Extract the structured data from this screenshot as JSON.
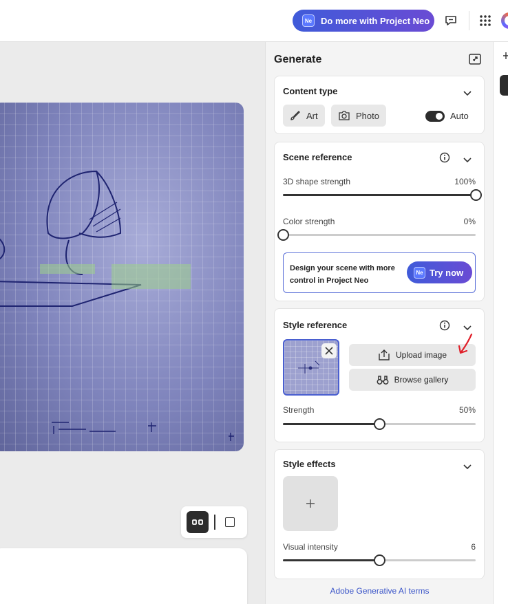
{
  "topbar": {
    "neo_button_label": "Do more with Project Neo",
    "neo_badge": "Ne"
  },
  "panel": {
    "title": "Generate",
    "content_type": {
      "title": "Content type",
      "art_label": "Art",
      "photo_label": "Photo",
      "auto_label": "Auto",
      "auto_on": true
    },
    "scene_reference": {
      "title": "Scene reference",
      "shape_label": "3D shape strength",
      "shape_value": "100%",
      "shape_level": 1.0,
      "color_label": "Color strength",
      "color_value": "0%",
      "color_level": 0.0,
      "promo_text": "Design your scene with more control in Project Neo",
      "try_label": "Try now",
      "try_badge": "Ne"
    },
    "style_reference": {
      "title": "Style reference",
      "upload_label": "Upload image",
      "browse_label": "Browse gallery",
      "strength_label": "Strength",
      "strength_value": "50%",
      "strength_level": 0.5
    },
    "style_effects": {
      "title": "Style effects",
      "intensity_label": "Visual intensity",
      "intensity_value": "6",
      "intensity_level": 0.5
    },
    "terms_link": "Adobe Generative AI terms"
  },
  "colors": {
    "accent": "#3f5bd9",
    "annotation_arrow": "#e0202a"
  }
}
